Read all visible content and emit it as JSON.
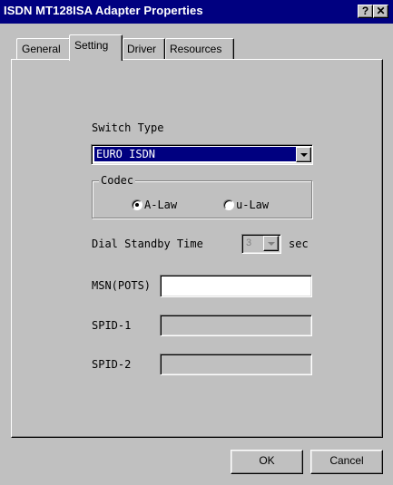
{
  "window": {
    "title": "ISDN MT128ISA Adapter Properties",
    "help_glyph": "?",
    "close_glyph": "✕"
  },
  "tabs": [
    {
      "label": "General",
      "selected": false
    },
    {
      "label": "Setting",
      "selected": true
    },
    {
      "label": "Driver",
      "selected": false
    },
    {
      "label": "Resources",
      "selected": false
    }
  ],
  "setting": {
    "switch_type_label": "Switch Type",
    "switch_type_value": "EURO ISDN",
    "codec_label": "Codec",
    "codec_options": [
      {
        "label": "A-Law",
        "selected": true
      },
      {
        "label": "u-Law",
        "selected": false
      }
    ],
    "dial_standby_label": "Dial Standby Time",
    "dial_standby_value": "3",
    "dial_standby_unit": "sec",
    "msn_label": "MSN(POTS)",
    "msn_value": "",
    "spid1_label": "SPID-1",
    "spid1_value": "",
    "spid2_label": "SPID-2",
    "spid2_value": ""
  },
  "buttons": {
    "ok_label": "OK",
    "cancel_label": "Cancel"
  },
  "colors": {
    "titlebar": "#000080",
    "face": "#c0c0c0",
    "selection": "#000080"
  }
}
